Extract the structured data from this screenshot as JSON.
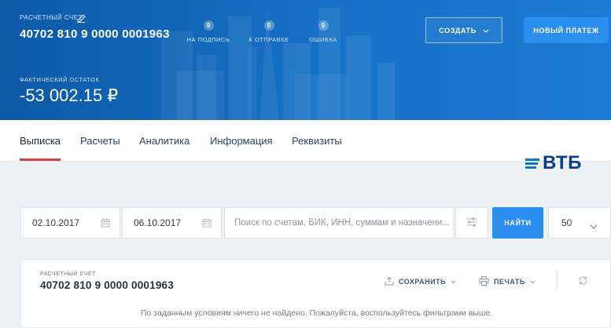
{
  "header": {
    "account_label": "РАСЧЕТНЫЙ СЧЕТ",
    "account_number": "40702 810 9 0000 0001963",
    "counters": [
      {
        "count": "0",
        "label": "НА ПОДПИСЬ"
      },
      {
        "count": "0",
        "label": "К ОТПРАВКЕ"
      },
      {
        "count": "0",
        "label": "ОШИБКА"
      }
    ],
    "create_label": "СОЗДАТЬ",
    "new_payment_label": "НОВЫЙ ПЛАТЕЖ",
    "balance_label": "ФАКТИЧЕСКИЙ ОСТАТОК",
    "balance_value": "-53 002.15 ₽"
  },
  "tabs": [
    {
      "label": "Выписка",
      "active": true
    },
    {
      "label": "Расчеты",
      "active": false
    },
    {
      "label": "Аналитика",
      "active": false
    },
    {
      "label": "Информация",
      "active": false
    },
    {
      "label": "Реквизиты",
      "active": false
    }
  ],
  "logo": {
    "text": "ВТБ"
  },
  "filters": {
    "date_from": "02.10.2017",
    "date_to": "06.10.2017",
    "search_placeholder": "Поиск по счетам, БИК, ИНН, суммам и назначени...",
    "find_label": "НАЙТИ",
    "per_page": "50"
  },
  "result": {
    "account_label": "РАСЧЕТНЫЙ СЧЕТ",
    "account_number": "40702 810 9 0000 0001963",
    "save_label": "СОХРАНИТЬ",
    "print_label": "ПЕЧАТЬ",
    "empty_message": "По заданным условиям ничего не найдено. Пожалуйста, воспользуйтесь фильтрами выше."
  },
  "colors": {
    "header_blue": "#1772c8",
    "primary_button": "#2a8ff0",
    "tab_underline": "#c9463d",
    "logo_navy": "#0e3c8a"
  }
}
